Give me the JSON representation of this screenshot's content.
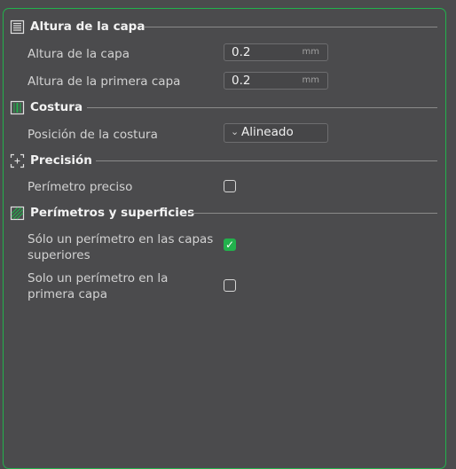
{
  "colors": {
    "accent": "#22b14c",
    "background": "#4b4b4d"
  },
  "sections": [
    {
      "title": "Altura de la capa",
      "icon": "layer-height-icon",
      "settings": [
        {
          "label": "Altura de la capa",
          "value": "0.2",
          "unit": "mm"
        },
        {
          "label": "Altura de la primera capa",
          "value": "0.2",
          "unit": "mm"
        }
      ]
    },
    {
      "title": "Costura",
      "icon": "seam-icon",
      "settings": [
        {
          "label": "Posición de la costura",
          "value": "Alineado"
        }
      ]
    },
    {
      "title": "Precisión",
      "icon": "precision-icon",
      "settings": [
        {
          "label": "Perímetro preciso",
          "checked": false
        }
      ]
    },
    {
      "title": "Perímetros y superficies",
      "icon": "walls-surfaces-icon",
      "settings": [
        {
          "label_line1": "Sólo un perímetro en las capas",
          "label_line2": "superiores",
          "checked": true
        },
        {
          "label_line1": "Solo un perímetro en la",
          "label_line2": "primera capa",
          "checked": false
        }
      ]
    }
  ]
}
